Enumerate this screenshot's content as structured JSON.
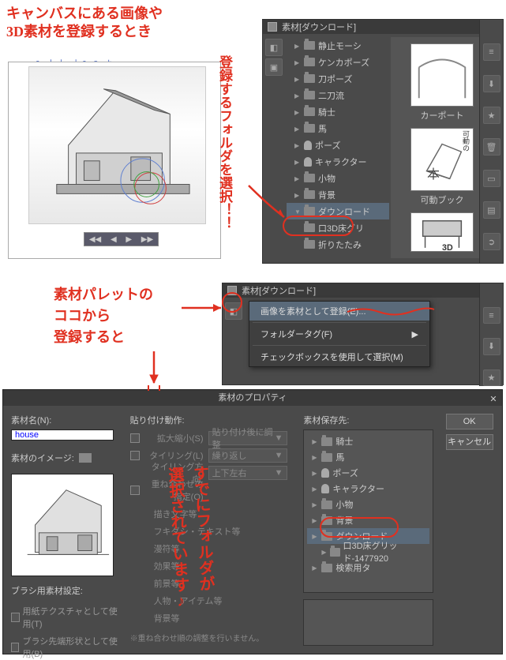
{
  "annotations": {
    "a1": "キャンバスにある画像や\n3D素材を登録するとき",
    "a2": "登録するフォルダを選択！！",
    "a3": "素材パレットの\nココから\n登録すると",
    "a4": "すでにフォルダが\n選択されています♪"
  },
  "blue_ruler": "0 十十 十0 8 よ",
  "panel_top": {
    "title": "素材[ダウンロード]",
    "tree": [
      {
        "label": "静止モーシ",
        "t": "folder",
        "arrow": "▶"
      },
      {
        "label": "ケンカポーズ",
        "t": "folder",
        "arrow": "▶"
      },
      {
        "label": "刀ポーズ",
        "t": "folder",
        "arrow": "▶"
      },
      {
        "label": "二刀流",
        "t": "folder",
        "arrow": "▶"
      },
      {
        "label": "騎士",
        "t": "folder",
        "arrow": "▶"
      },
      {
        "label": "馬",
        "t": "folder",
        "arrow": "▶"
      },
      {
        "label": "ポーズ",
        "t": "person",
        "arrow": "▶"
      },
      {
        "label": "キャラクター",
        "t": "person",
        "arrow": "▶"
      },
      {
        "label": "小物",
        "t": "folder",
        "arrow": "▶"
      },
      {
        "label": "背景",
        "t": "folder",
        "arrow": "▶"
      },
      {
        "label": "ダウンロード",
        "t": "folder",
        "arrow": "▼",
        "sel": true
      },
      {
        "label": "口3D床グリ",
        "t": "folder",
        "arrow": ""
      },
      {
        "label": "折りたたみ",
        "t": "folder",
        "arrow": ""
      }
    ],
    "thumbs": [
      {
        "label": "カーポート"
      },
      {
        "label": "可動ブック",
        "badge": "可動の"
      },
      {
        "label": "3D"
      }
    ]
  },
  "panel_mid": {
    "title": "素材[ダウンロード]",
    "menu": [
      {
        "label": "画像を素材として登録(E)...",
        "hl": true
      },
      {
        "label": "フォルダータグ(F)",
        "arrow": "▶"
      },
      {
        "label": "チェックボックスを使用して選択(M)"
      }
    ]
  },
  "dialog": {
    "title": "素材のプロパティ",
    "name_label": "素材名(N):",
    "name_value": "house",
    "image_label": "素材のイメージ:",
    "brush_label": "ブラシ用素材設定:",
    "chk1": "用紙テクスチャとして使用(T)",
    "chk2": "ブラシ先端形状として使用(B)",
    "paste_label": "貼り付け動作:",
    "opts": [
      {
        "l": "拡大縮小(S)",
        "v": "貼り付け後に調整",
        "chk": true
      },
      {
        "l": "タイリング(L)",
        "v": "繰り返し",
        "chk": true
      },
      {
        "l": "タイリング方向:",
        "v": "上下左右"
      },
      {
        "l": "重ね合わせの指定(O)",
        "v": "",
        "chk": true
      }
    ],
    "cats": [
      "描き文字等",
      "フキダシ・テキスト等",
      "漫符等",
      "効果等",
      "前景等",
      "人物・アイテム等",
      "背景等"
    ],
    "cats_note": "※重ね合わせ順の調整を行いません。",
    "save_label": "素材保存先:",
    "tree": [
      {
        "label": "騎士",
        "t": "folder"
      },
      {
        "label": "馬",
        "t": "folder"
      },
      {
        "label": "ポーズ",
        "t": "person"
      },
      {
        "label": "キャラクター",
        "t": "person"
      },
      {
        "label": "小物",
        "t": "folder"
      },
      {
        "label": "背景",
        "t": "folder"
      },
      {
        "label": "ダウンロード",
        "t": "folder",
        "sel": true
      },
      {
        "label": "口3D床グリッド-1477920",
        "t": "folder",
        "indent": true
      },
      {
        "label": "検索用タ",
        "t": "folder"
      }
    ],
    "ok": "OK",
    "cancel": "キャンセル"
  },
  "icons": {
    "book": "本"
  }
}
